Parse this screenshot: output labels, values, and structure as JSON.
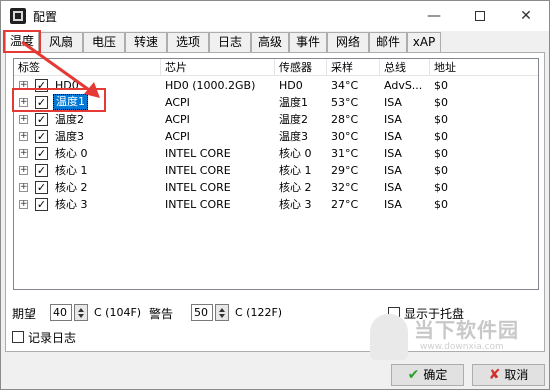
{
  "window": {
    "title": "配置"
  },
  "tabs": [
    "温度",
    "风扇",
    "电压",
    "转速",
    "选项",
    "日志",
    "高级",
    "事件",
    "网络",
    "邮件",
    "xAP"
  ],
  "active_tab": 0,
  "columns": [
    "标签",
    "芯片",
    "传感器",
    "采样",
    "总线",
    "地址"
  ],
  "rows": [
    {
      "label": "HD0",
      "chip": "HD0 (1000.2GB)",
      "sensor": "HD0",
      "sample": "34°C",
      "bus": "AdvS...",
      "addr": "$0",
      "selected": false
    },
    {
      "label": "温度1",
      "chip": "ACPI",
      "sensor": "温度1",
      "sample": "53°C",
      "bus": "ISA",
      "addr": "$0",
      "selected": true
    },
    {
      "label": "温度2",
      "chip": "ACPI",
      "sensor": "温度2",
      "sample": "28°C",
      "bus": "ISA",
      "addr": "$0",
      "selected": false
    },
    {
      "label": "温度3",
      "chip": "ACPI",
      "sensor": "温度3",
      "sample": "30°C",
      "bus": "ISA",
      "addr": "$0",
      "selected": false
    },
    {
      "label": "核心 0",
      "chip": "INTEL CORE",
      "sensor": "核心 0",
      "sample": "31°C",
      "bus": "ISA",
      "addr": "$0",
      "selected": false
    },
    {
      "label": "核心 1",
      "chip": "INTEL CORE",
      "sensor": "核心 1",
      "sample": "29°C",
      "bus": "ISA",
      "addr": "$0",
      "selected": false
    },
    {
      "label": "核心 2",
      "chip": "INTEL CORE",
      "sensor": "核心 2",
      "sample": "32°C",
      "bus": "ISA",
      "addr": "$0",
      "selected": false
    },
    {
      "label": "核心 3",
      "chip": "INTEL CORE",
      "sensor": "核心 3",
      "sample": "27°C",
      "bus": "ISA",
      "addr": "$0",
      "selected": false
    }
  ],
  "footer": {
    "desired_label": "期望",
    "desired_value": "40",
    "desired_unit": "C (104F)",
    "warning_label": "警告",
    "warning_value": "50",
    "warning_unit": "C (122F)",
    "show_tray_label": "显示于托盘",
    "log_label": "记录日志"
  },
  "buttons": {
    "ok": "确定",
    "cancel": "取消"
  },
  "watermark": {
    "brand": "当下软件园",
    "url": "www.downxia.com"
  },
  "colors": {
    "highlight": "#e53935",
    "selection": "#0078d7"
  },
  "icons": {
    "ok": "check-icon",
    "cancel": "x-icon"
  }
}
